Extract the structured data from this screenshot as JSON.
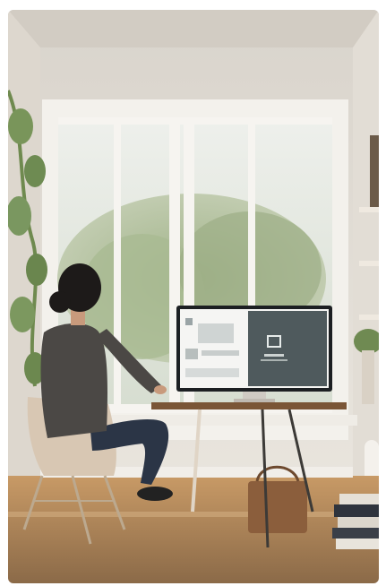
{
  "scene": {
    "kind": "photo",
    "subject_icon": "person-at-desk-icon",
    "monitor_screen_icon": "app-window-icon",
    "colors": {
      "wall": "#e9e4dc",
      "window_frame": "#f4f2ee",
      "foliage": "#8fa37a",
      "floor": "#b88a5a",
      "monitor_right_panel": "#4f5a5d",
      "sweater": "#4b4845",
      "jeans": "#2b3546",
      "chair": "#d8c7b3"
    }
  }
}
